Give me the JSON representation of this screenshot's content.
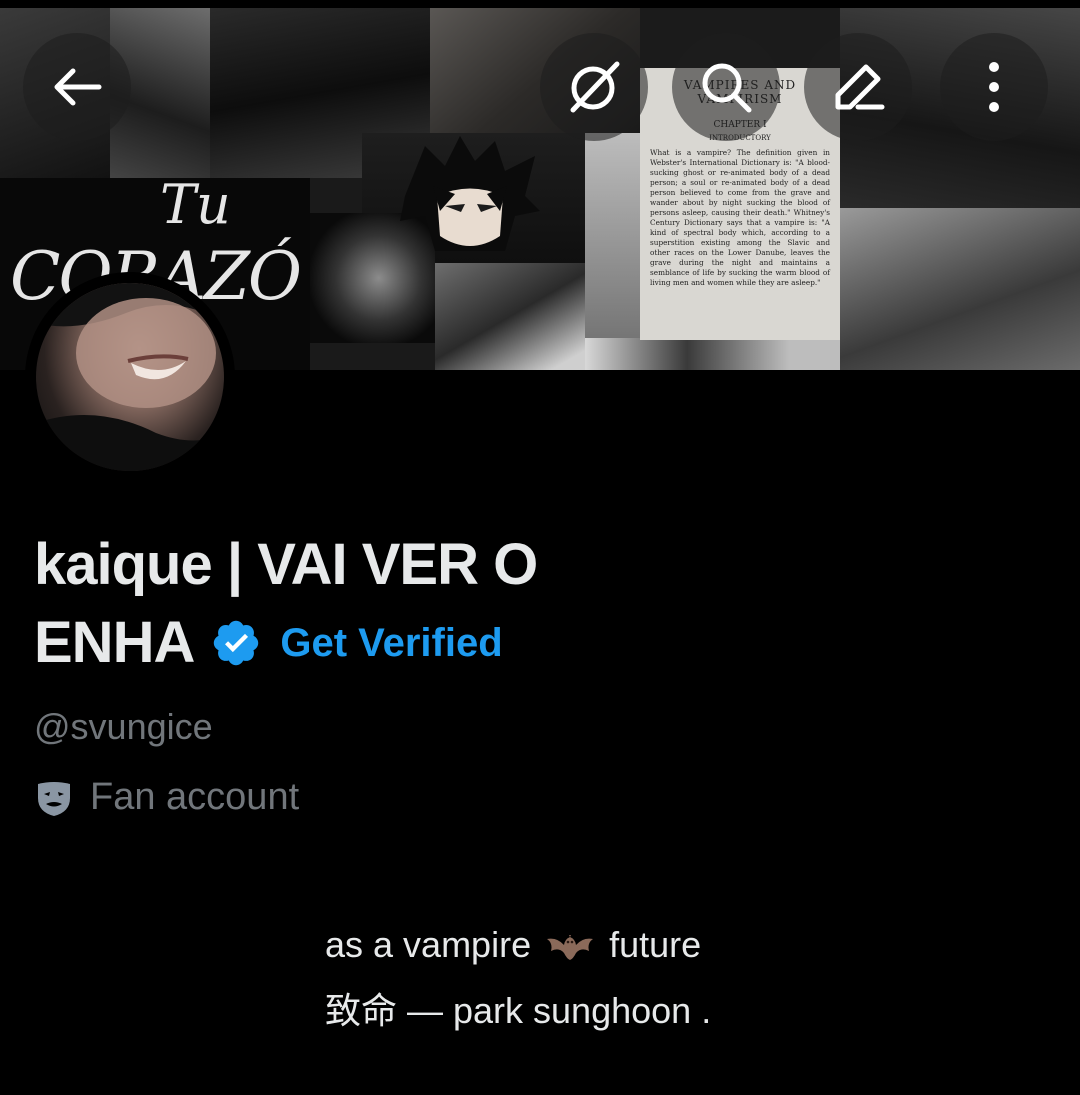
{
  "banner": {
    "gothic_line1": "Tu",
    "gothic_line2": "CORAZÓ",
    "book_title": "VAMPIRES AND VAMPIRISM",
    "book_chapter": "CHAPTER I",
    "book_intro": "INTRODUCTORY",
    "book_text": "What is a vampire? The definition given in Webster's International Dictionary is: \"A blood-sucking ghost or re-animated body of a dead person; a soul or re-animated body of a dead person believed to come from the grave and wander about by night sucking the blood of persons asleep, causing their death.\" Whitney's Century Dictionary says that a vampire is: \"A kind of spectral body which, according to a superstition existing among the Slavic and other races on the Lower Danube, leaves the grave during the night and maintains a semblance of life by sucking the warm blood of living men and women while they are asleep.\""
  },
  "topbar": {
    "back": "back-arrow-icon",
    "grok": "grok-icon",
    "search": "search-icon",
    "edit": "edit-icon",
    "more": "more-vertical-icon"
  },
  "profile": {
    "name_line1": "kaique | VAI VER O",
    "name_line2": "ENHA",
    "get_verified": "Get Verified",
    "handle": "@svungice",
    "category": "Fan account",
    "bio_line1_a": "as a vampire",
    "bio_line1_b": "future",
    "bio_line2": "致命 —   park sunghoon ."
  },
  "colors": {
    "background": "#000000",
    "text": "#e7e9ea",
    "muted": "#71767b",
    "accent": "#1d9bf0"
  }
}
